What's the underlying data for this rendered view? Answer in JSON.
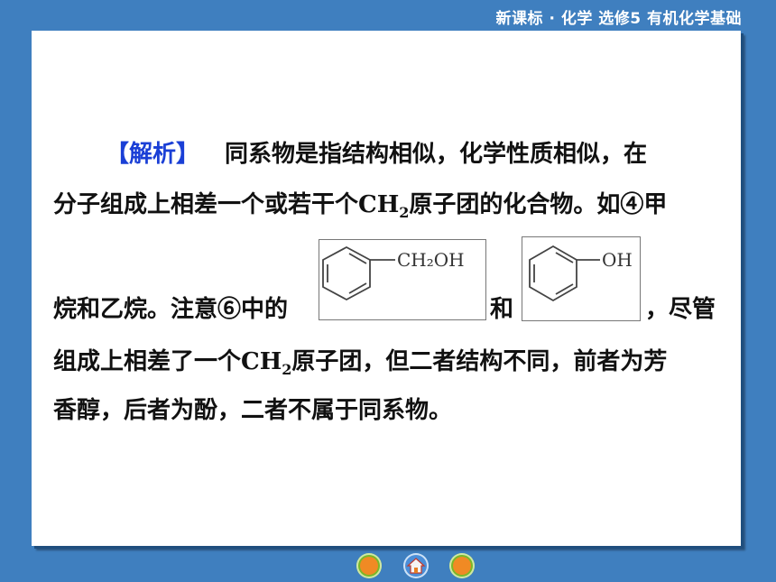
{
  "header": {
    "title": "新课标 · 化学  选修5  有机化学基础"
  },
  "content": {
    "tag": "【解析】",
    "line1": "同系物是指结构相似，化学性质相似，在",
    "line2_a": "分子组成上相差一个或若干个",
    "line2_formula": "CH",
    "line2_sub": "2",
    "line2_b": "原子团的化合物。如④甲",
    "line3_a": "烷和乙烷。注意⑥中的",
    "line3_and": "和",
    "line3_b": "，尽管",
    "line4_a": "组成上相差了一个",
    "line4_formula": "CH",
    "line4_sub": "2",
    "line4_b": "原子团，但二者结构不同，前者为芳",
    "line5": "香醇，后者为酚，二者不属于同系物。"
  },
  "structures": {
    "benzyl_alcohol_label": "CH₂OH",
    "phenol_label": "OH"
  },
  "nav": {
    "left_icon": "previous-icon",
    "home_icon": "home-icon",
    "right_icon": "next-icon"
  },
  "colors": {
    "background": "#3f7fbf",
    "tag": "#1a3fd6"
  }
}
